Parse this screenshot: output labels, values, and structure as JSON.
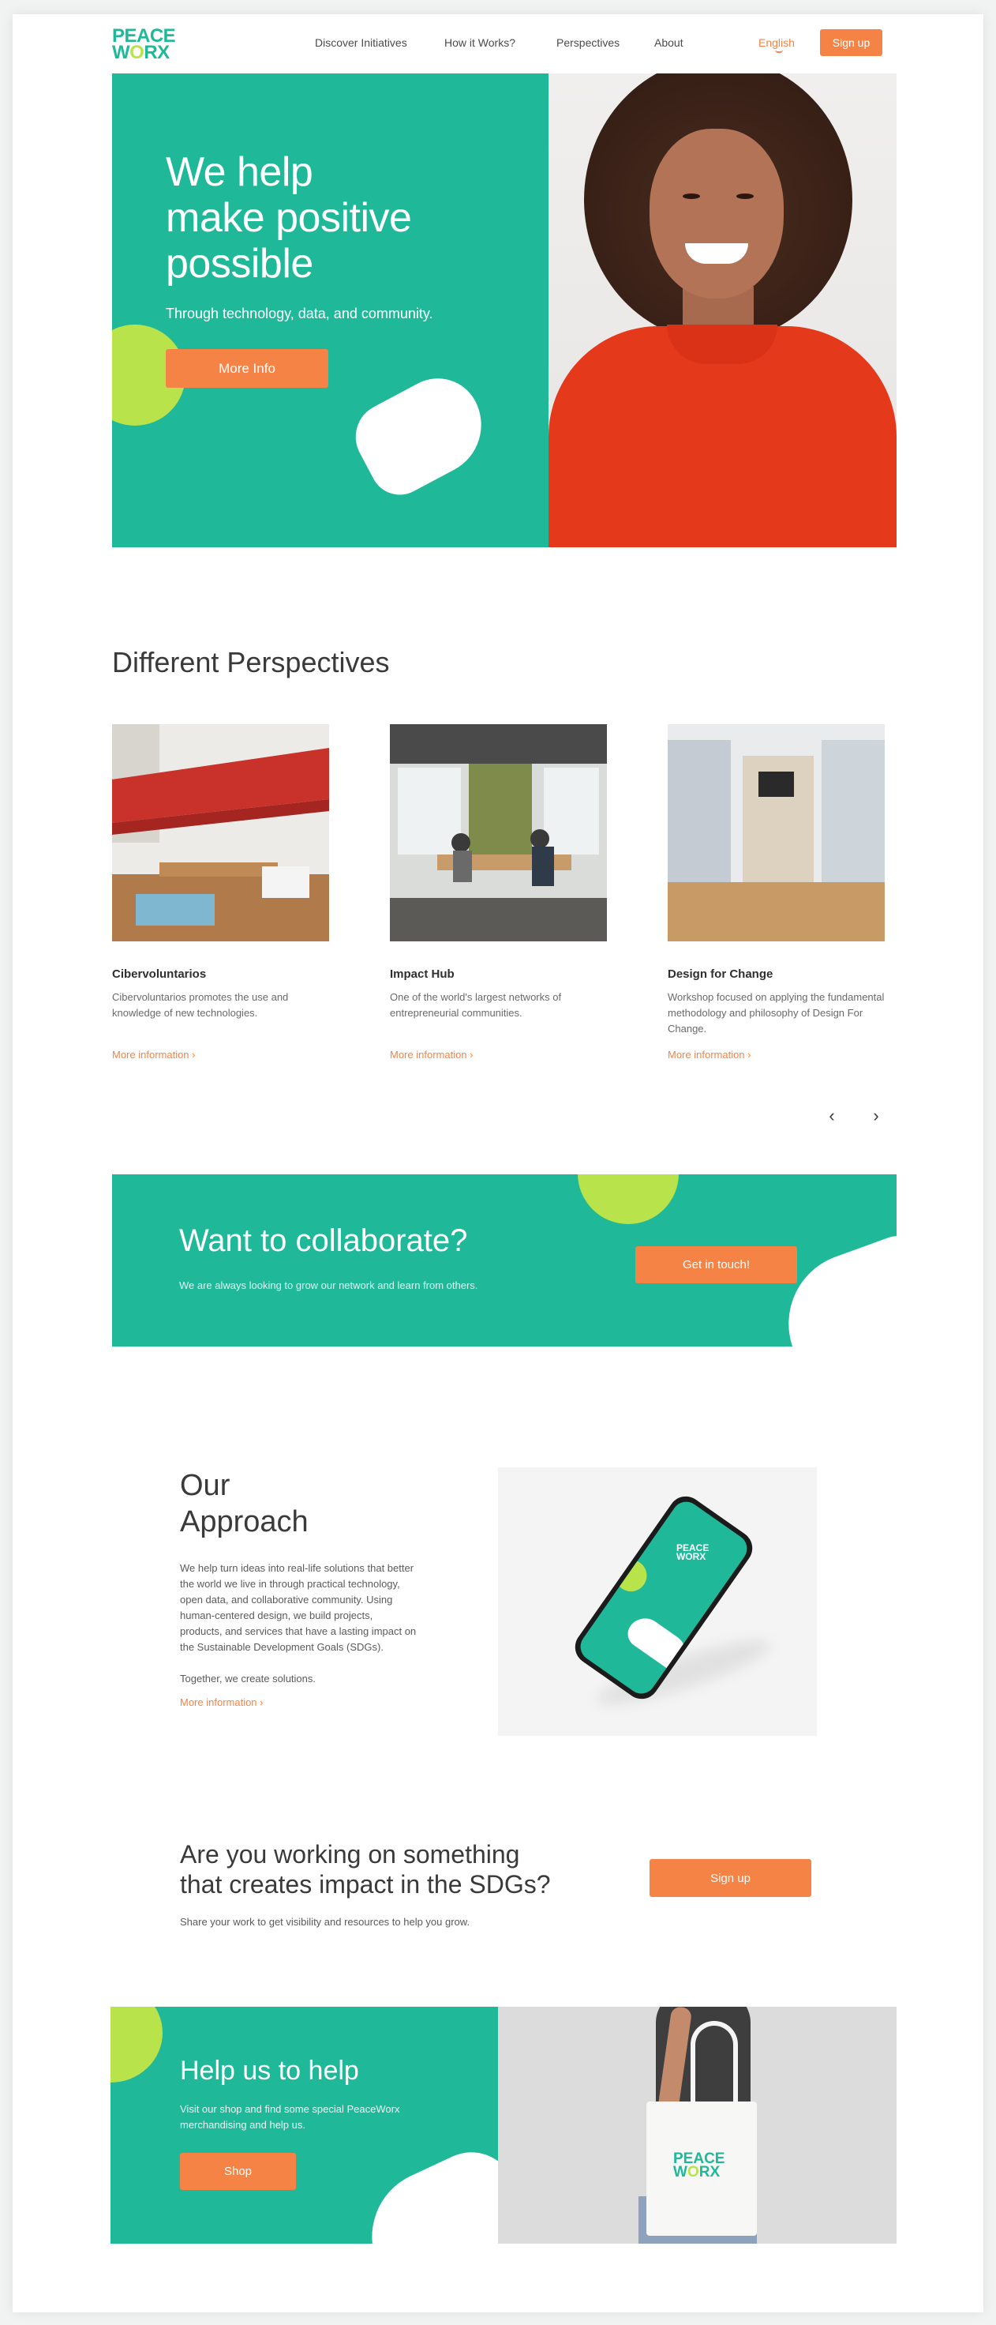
{
  "brand": {
    "line1": "PEACE",
    "line2a": "W",
    "line2o": "O",
    "line2b": "RX"
  },
  "nav": {
    "items": [
      "Discover Initiatives",
      "How it Works?",
      "Perspectives",
      "About"
    ],
    "language": "English",
    "signup": "Sign up"
  },
  "hero": {
    "title_l1": "We help",
    "title_l2": "make positive",
    "title_l3": "possible",
    "subtitle": "Through technology, data, and community.",
    "button": "More Info"
  },
  "perspectives": {
    "heading": "Different Perspectives",
    "cards": [
      {
        "title": "Cibervoluntarios",
        "desc": "Cibervoluntarios promotes the use and knowledge of new technologies.",
        "link": "More information ›"
      },
      {
        "title": "Impact Hub",
        "desc": "One of the world's largest networks of entrepreneurial communities.",
        "link": "More information ›"
      },
      {
        "title": "Design for Change",
        "desc": "Workshop focused on applying the fundamental methodology and philosophy of Design For Change.",
        "link": "More information ›"
      }
    ],
    "prev": "‹",
    "next": "›"
  },
  "collab": {
    "title": "Want to collaborate?",
    "text": "We are always looking to grow our network and learn from others.",
    "button": "Get in touch!"
  },
  "approach": {
    "title_l1": "Our",
    "title_l2": "Approach",
    "p1": "We help turn ideas into real-life solutions that better the world we live in through practical technology, open data, and collaborative community. Using human-centered design, we build projects, products, and services that have a lasting impact on the Sustainable Development Goals (SDGs).",
    "p2": "Together, we create solutions.",
    "link": "More information ›",
    "phone_logo_l1": "PEACE",
    "phone_logo_l2": "WORX"
  },
  "sdg": {
    "title_l1": "Are you working on something",
    "title_l2": "that creates impact in the SDGs?",
    "text": "Share your work to get visibility and resources to help you grow.",
    "button": "Sign up"
  },
  "help": {
    "title": "Help us to help",
    "text": "Visit our shop and find some special PeaceWorx merchandising and help us.",
    "button": "Shop",
    "bag_l1": "PEACE",
    "bag_l2a": "W",
    "bag_l2o": "O",
    "bag_l2b": "RX"
  },
  "colors": {
    "teal": "#1fb99a",
    "lime": "#b8e34a",
    "orange": "#f58345"
  }
}
